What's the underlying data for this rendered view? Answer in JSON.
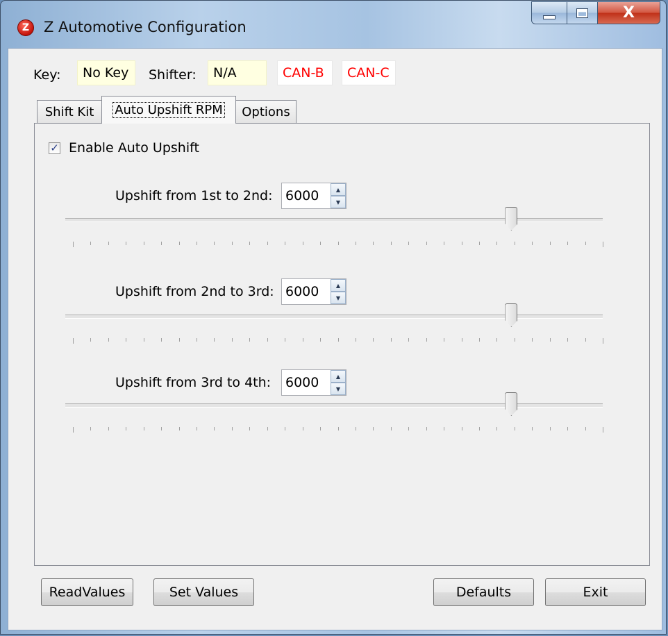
{
  "window": {
    "title": "Z Automotive Configuration",
    "app_icon_glyph": "Z",
    "close_glyph": "X"
  },
  "status": {
    "key_label": "Key:",
    "key_value": "No Key",
    "shifter_label": "Shifter:",
    "shifter_value": "N/A",
    "can_b": "CAN-B",
    "can_c": "CAN-C"
  },
  "tabs": [
    {
      "label": "Shift Kit"
    },
    {
      "label": "Auto Upshift RPM",
      "active": true
    },
    {
      "label": "Options"
    }
  ],
  "panel": {
    "enable_label": "Enable Auto Upshift",
    "enable_checked": true,
    "check_glyph": "✓",
    "upshifts": [
      {
        "label": "Upshift from 1st to 2nd:",
        "value": "6000",
        "slider_fraction": 0.83
      },
      {
        "label": "Upshift from 2nd to 3rd:",
        "value": "6000",
        "slider_fraction": 0.83
      },
      {
        "label": "Upshift from 3rd to 4th:",
        "value": "6000",
        "slider_fraction": 0.83
      }
    ]
  },
  "buttons": {
    "read": "ReadValues",
    "set": "Set Values",
    "defaults": "Defaults",
    "exit": "Exit"
  },
  "colors": {
    "status_yellow": "#ffffe1",
    "can_red": "#ff0000"
  }
}
